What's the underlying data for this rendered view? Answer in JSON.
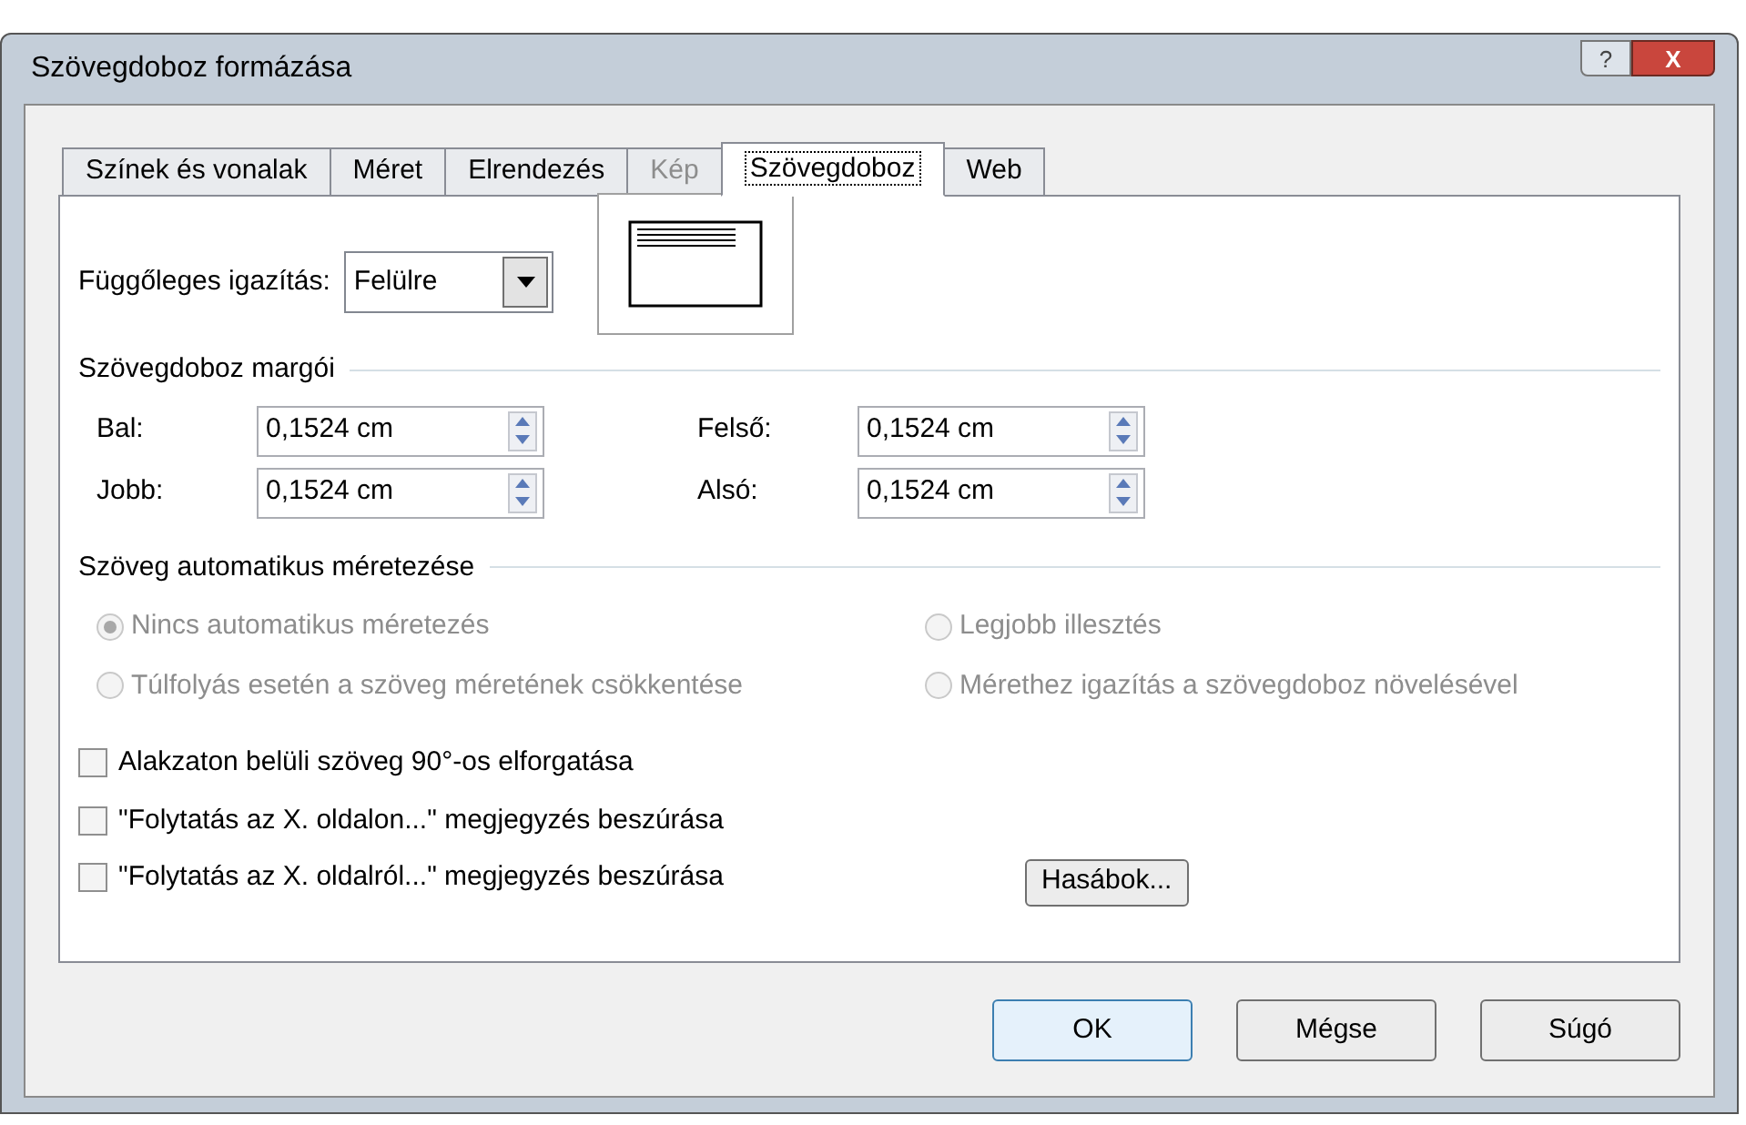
{
  "window": {
    "title": "Szövegdoboz formázása",
    "buttons": [
      "?",
      "X"
    ]
  },
  "tabs": [
    {
      "label": "Színek és vonalak",
      "selected": false,
      "disabled": false
    },
    {
      "label": "Méret",
      "selected": false,
      "disabled": false
    },
    {
      "label": "Elrendezés",
      "selected": false,
      "disabled": false
    },
    {
      "label": "Kép",
      "selected": false,
      "disabled": true
    },
    {
      "label": "Szövegdoboz",
      "selected": true,
      "disabled": false
    },
    {
      "label": "Web",
      "selected": false,
      "disabled": false
    }
  ],
  "vertical_alignment": {
    "label": "Függőleges igazítás:",
    "value": "Felülre"
  },
  "margins": {
    "title": "Szövegdoboz margói",
    "fields": [
      {
        "label": "Bal:",
        "value": "0,1524 cm"
      },
      {
        "label": "Felső:",
        "value": "0,1524 cm"
      },
      {
        "label": "Jobb:",
        "value": "0,1524 cm"
      },
      {
        "label": "Alsó:",
        "value": "0,1524 cm"
      }
    ]
  },
  "autosize": {
    "title": "Szöveg automatikus méretezése",
    "options": [
      {
        "label": "Nincs automatikus méretezés",
        "selected": true,
        "disabled": true
      },
      {
        "label": "Legjobb illesztés",
        "selected": false,
        "disabled": true
      },
      {
        "label": "Túlfolyás esetén a szöveg méretének csökkentése",
        "selected": false,
        "disabled": true
      },
      {
        "label": "Mérethez igazítás a szövegdoboz növelésével",
        "selected": false,
        "disabled": true
      }
    ]
  },
  "checkboxes": [
    {
      "label": "Alakzaton belüli szöveg 90°-os elforgatása",
      "checked": false
    },
    {
      "label": "\"Folytatás az X. oldalon...\" megjegyzés beszúrása",
      "checked": false
    },
    {
      "label": "\"Folytatás az X. oldalról...\" megjegyzés beszúrása",
      "checked": false
    }
  ],
  "columns_button": "Hasábok...",
  "footer_buttons": [
    {
      "label": "OK",
      "selected": true
    },
    {
      "label": "Mégse",
      "selected": false
    },
    {
      "label": "Súgó",
      "selected": false
    }
  ]
}
